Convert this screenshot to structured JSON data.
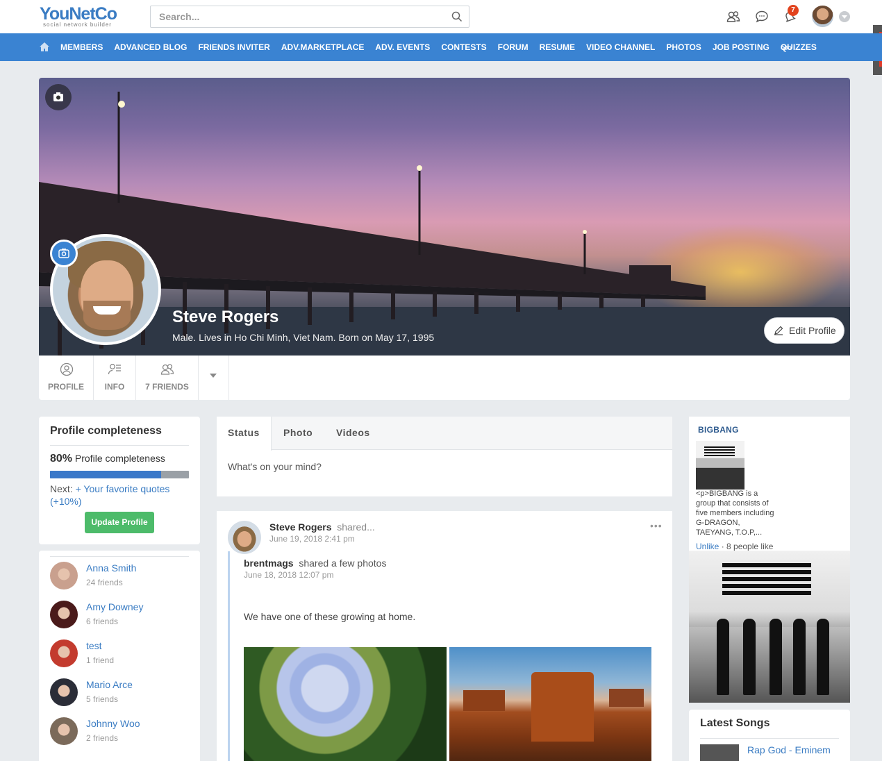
{
  "header": {
    "logo_text": "YouNetCo",
    "logo_tagline": "social network builder",
    "search_placeholder": "Search...",
    "notification_count": "7"
  },
  "nav": {
    "items": [
      "MEMBERS",
      "ADVANCED BLOG",
      "FRIENDS INVITER",
      "ADV.MARKETPLACE",
      "ADV. EVENTS",
      "CONTESTS",
      "FORUM",
      "RESUME",
      "VIDEO CHANNEL",
      "PHOTOS",
      "JOB POSTING",
      "QUIZZES"
    ]
  },
  "profile": {
    "name": "Steve Rogers",
    "info": "Male. Lives in Ho Chi Minh,  Viet Nam. Born on May 17, 1995",
    "edit_label": "Edit Profile",
    "tabs": [
      "PROFILE",
      "INFO",
      "7 FRIENDS"
    ]
  },
  "completeness": {
    "title": "Profile completeness",
    "percent_text": "80%",
    "percent_label": "Profile completeness",
    "percent_value": 80,
    "next_prefix": "Next: ",
    "next_link": "+ Your favorite quotes (+10%)",
    "button": "Update Profile"
  },
  "friends": [
    {
      "name": "Anna Smith",
      "count": "24 friends",
      "color": "#c9a08e"
    },
    {
      "name": "Amy Downey",
      "count": "6 friends",
      "color": "#4a1a1a"
    },
    {
      "name": "test",
      "count": "1 friend",
      "color": "#c33b2e"
    },
    {
      "name": "Mario Arce",
      "count": "5 friends",
      "color": "#2b2d38"
    },
    {
      "name": "Johnny Woo",
      "count": "2 friends",
      "color": "#7b6a5a"
    }
  ],
  "composer": {
    "tabs": [
      "Status",
      "Photo",
      "Videos"
    ],
    "placeholder": "What's on your mind?"
  },
  "post": {
    "author": "Steve Rogers",
    "action": "shared...",
    "time": "June 19, 2018 2:41 pm",
    "more": "•••",
    "shared_author": "brentmags",
    "shared_action": "shared a few photos",
    "shared_time": "June 18, 2018 12:07 pm",
    "message": "We have one of these growing at home."
  },
  "sidebar": {
    "page_title": "BIGBANG",
    "page_desc": "<p>BIGBANG is a group that consists of five members including G-DRAGON, TAEYANG, T.O.P,...",
    "unlike": "Unlike",
    "likes": " · 8 people like",
    "songs_title": "Latest Songs",
    "song": "Rap God - Eminem"
  }
}
